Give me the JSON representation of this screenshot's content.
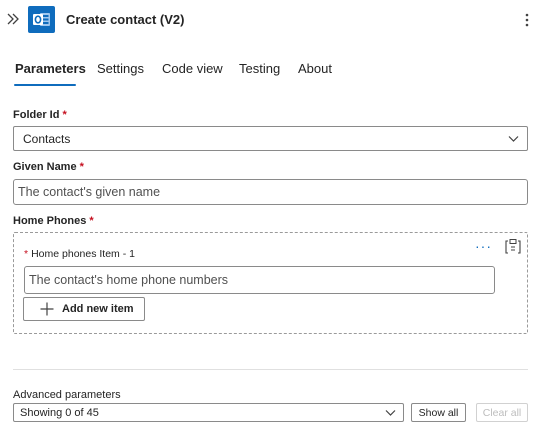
{
  "header": {
    "title": "Create contact (V2)",
    "app_icon": "outlook-icon",
    "brand_color": "#0f6cbd"
  },
  "tabs": [
    {
      "label": "Parameters",
      "active": true
    },
    {
      "label": "Settings",
      "active": false
    },
    {
      "label": "Code view",
      "active": false
    },
    {
      "label": "Testing",
      "active": false
    },
    {
      "label": "About",
      "active": false
    }
  ],
  "folder_id": {
    "label": "Folder Id",
    "required_mark": "*",
    "value": "Contacts"
  },
  "given_name": {
    "label": "Given Name",
    "required_mark": "*",
    "placeholder": "The contact's given name"
  },
  "home_phones": {
    "label": "Home Phones",
    "required_mark": "*",
    "item": {
      "required_mark": "*",
      "label": "Home phones Item - 1",
      "placeholder": "The contact's home phone numbers",
      "menu_glyph": "···"
    },
    "add_button": "Add new item"
  },
  "advanced": {
    "label": "Advanced parameters",
    "value": "Showing 0 of 45",
    "show_all": "Show all",
    "clear_all": "Clear all"
  },
  "colors": {
    "accent": "#0f6cbd",
    "required": "#c50f1f"
  }
}
